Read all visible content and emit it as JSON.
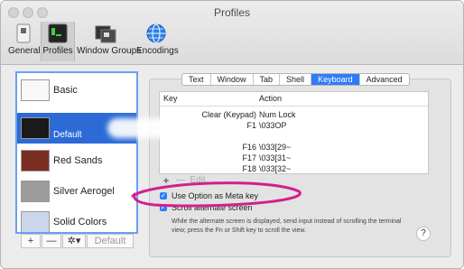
{
  "window": {
    "title": "Profiles"
  },
  "toolbar": {
    "general": "General",
    "profiles": "Profiles",
    "window_groups": "Window Groups",
    "encodings": "Encodings"
  },
  "profiles": [
    {
      "name": "Basic",
      "selected": false
    },
    {
      "name": "Default",
      "selected": true
    },
    {
      "name": "Red Sands",
      "selected": false
    },
    {
      "name": "Silver Aerogel",
      "selected": false
    },
    {
      "name": "Solid Colors",
      "selected": false
    }
  ],
  "sidebar_controls": {
    "add": "+",
    "remove": "—",
    "gear": "✲▾",
    "default": "Default"
  },
  "tabs": [
    {
      "label": "Text",
      "active": false
    },
    {
      "label": "Window",
      "active": false
    },
    {
      "label": "Tab",
      "active": false
    },
    {
      "label": "Shell",
      "active": false
    },
    {
      "label": "Keyboard",
      "active": true
    },
    {
      "label": "Advanced",
      "active": false
    }
  ],
  "key_table": {
    "headers": {
      "key": "Key",
      "action": "Action"
    },
    "rows": [
      {
        "key": "Clear (Keypad)",
        "action": "Num Lock"
      },
      {
        "key": "F1",
        "action": "\\033OP"
      },
      {
        "key": "",
        "action": ""
      },
      {
        "key": "F16",
        "action": "\\033[29~"
      },
      {
        "key": "F17",
        "action": "\\033[31~"
      },
      {
        "key": "F18",
        "action": "\\033[32~"
      }
    ]
  },
  "table_controls": {
    "add": "+",
    "remove": "—",
    "edit": "Edit"
  },
  "options": {
    "option_meta": "Use Option as Meta key",
    "scroll_alt": "Scroll alternate screen"
  },
  "help_text": "While the alternate screen is displayed, send input instead of scrolling the terminal view; press the Fn or Shift key to scroll the view.",
  "help_button": "?"
}
